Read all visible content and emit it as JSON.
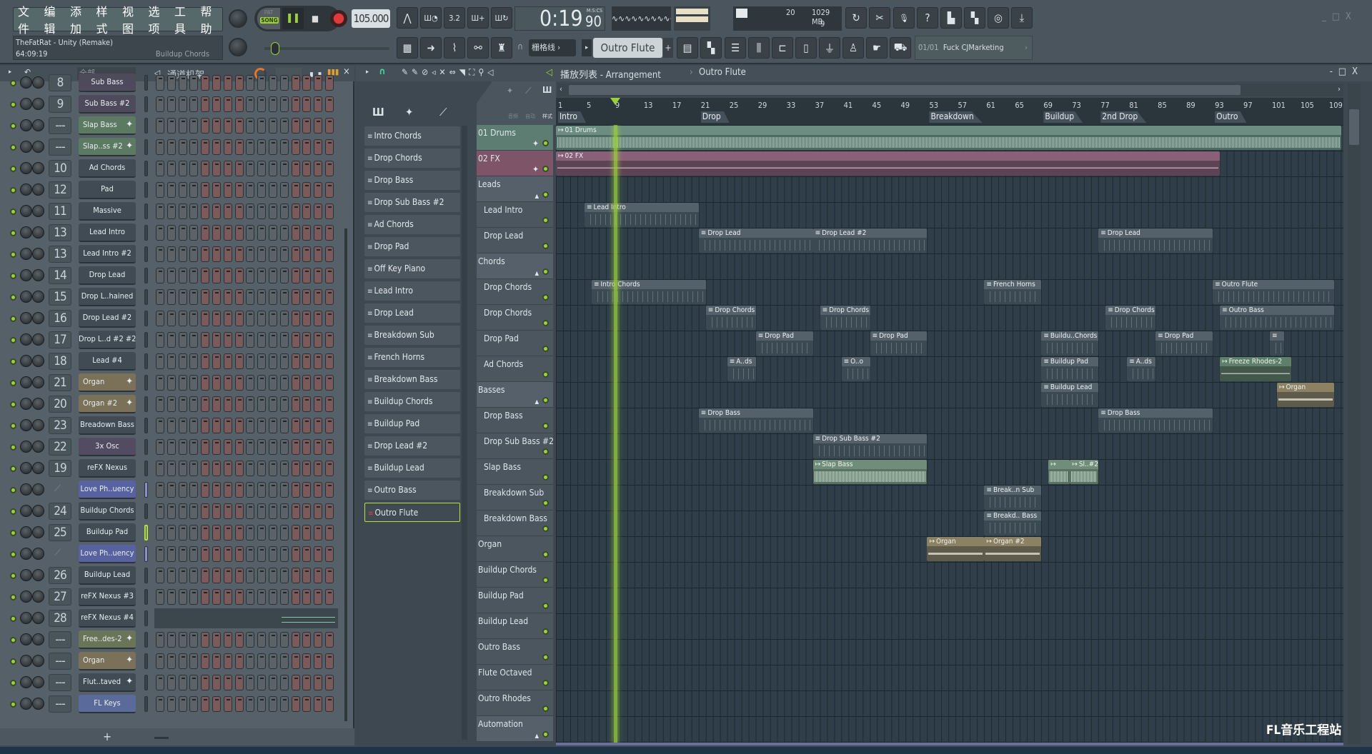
{
  "menu": [
    "文件",
    "编辑",
    "添加",
    "样式",
    "视图",
    "选项",
    "工具",
    "帮助"
  ],
  "transport": {
    "mode_pat": "PAT",
    "mode_song": "SONG",
    "tempo": "105.000",
    "time": "0:19",
    "time_cs": "90",
    "time_format": "M:S:CS"
  },
  "cpu": {
    "polyphony": "20",
    "memory": "1029 MB",
    "voices": "9"
  },
  "song_info": {
    "title": "TheFatRat - Unity (Remake)",
    "time": "64:09:19",
    "hint": "Buildup Chords"
  },
  "snap": "栅格线",
  "current_pattern": "Outro Flute",
  "hint_bar": {
    "index": "01/01",
    "text": "Fuck CJMarketing"
  },
  "toolbar_icons_row1": [
    "tempo-tap-icon",
    "metronome-icon",
    "countdown-icon",
    "step-edit-icon",
    "loop-record-icon"
  ],
  "toolbar_icons_right": [
    "undo-icon",
    "cut-icon",
    "record-audio-icon",
    "help-icon",
    "save-icon",
    "export-icon",
    "chat-icon",
    "download-icon"
  ],
  "toolbar_icons_row2": [
    "piano-roll-icon",
    "arrow-icon",
    "brush-icon",
    "link-icon",
    "stamp-icon"
  ],
  "toolbar_icons_row2b": [
    "playlist-icon",
    "step-seq-icon",
    "channel-rack-icon",
    "mixer-icon",
    "browser-icon",
    "file-icon",
    "plugin-icon",
    "performer-icon",
    "hand-icon",
    "shop-icon"
  ],
  "channel_rack": {
    "filter": "全部",
    "title": "通道机架",
    "add": "+",
    "channels": [
      {
        "num": "8",
        "name": "Sub Bass",
        "color": "#4e4a5c"
      },
      {
        "num": "9",
        "name": "Sub Bass #2",
        "color": "#4e4a5c"
      },
      {
        "num": "---",
        "name": "Slap Bass",
        "color": "#5c7a62",
        "sampler": true
      },
      {
        "num": "---",
        "name": "Slap..ss #2",
        "color": "#5c7a62",
        "sampler": true
      },
      {
        "num": "10",
        "name": "Ad Chords",
        "color": "#414b53"
      },
      {
        "num": "12",
        "name": "Pad",
        "color": "#414b53"
      },
      {
        "num": "11",
        "name": "Massive",
        "color": "#414b53"
      },
      {
        "num": "13",
        "name": "Lead Intro",
        "color": "#414b53"
      },
      {
        "num": "13",
        "name": "Lead Intro #2",
        "color": "#414b53"
      },
      {
        "num": "14",
        "name": "Drop  Lead",
        "color": "#414b53"
      },
      {
        "num": "15",
        "name": "Drop  L..hained",
        "color": "#414b53"
      },
      {
        "num": "16",
        "name": "Drop Lead  #2",
        "color": "#414b53"
      },
      {
        "num": "17",
        "name": "Drop L..d  #2 #2",
        "color": "#414b53"
      },
      {
        "num": "18",
        "name": "Lead #4",
        "color": "#414b53"
      },
      {
        "num": "21",
        "name": "Organ",
        "color": "#7a7158",
        "sampler": true
      },
      {
        "num": "20",
        "name": "Organ  #2",
        "color": "#7a7158",
        "sampler": true
      },
      {
        "num": "23",
        "name": "Breadown Bass",
        "color": "#414b53"
      },
      {
        "num": "22",
        "name": "3x Osc",
        "color": "#524b62"
      },
      {
        "num": "19",
        "name": "reFX Nexus",
        "color": "#414b53"
      },
      {
        "num": "",
        "name": "Love Ph..uency",
        "color": "#5862a0",
        "link": true
      },
      {
        "num": "24",
        "name": "Buildup Chords",
        "color": "#414b53"
      },
      {
        "num": "25",
        "name": "Buildup  Pad",
        "color": "#414b53",
        "selected": true
      },
      {
        "num": "",
        "name": "Love Ph..uency",
        "color": "#5862a0",
        "link": true
      },
      {
        "num": "26",
        "name": "Buildup  Lead",
        "color": "#414b53"
      },
      {
        "num": "27",
        "name": "reFX Nexus #3",
        "color": "#414b53"
      },
      {
        "num": "28",
        "name": "reFX Nexus #4",
        "color": "#414b53",
        "pianoroll": true
      },
      {
        "num": "---",
        "name": "Free..des-2",
        "color": "#6a7458",
        "sampler": true
      },
      {
        "num": "---",
        "name": "Organ",
        "color": "#7a7158",
        "sampler": true
      },
      {
        "num": "---",
        "name": "Flut..taved",
        "color": "#414b53",
        "sampler": true
      },
      {
        "num": "---",
        "name": "FL Keys",
        "color": "#5a6a9a"
      }
    ],
    "steps_per_pattern": 16
  },
  "playlist": {
    "title": "播放列表 - Arrangement",
    "pattern": "Outro Flute",
    "filter_labels": [
      "音频",
      "自动",
      "样式"
    ],
    "picker": [
      "Intro Chords",
      "Drop  Chords",
      "Drop Bass",
      "Drop Sub Bass #2",
      "Ad Chords",
      "Drop  Pad",
      "Off Key Piano",
      "Lead Intro",
      "Drop Lead",
      "Breakdown Sub",
      "French Horns",
      "Breakdown  Bass",
      "Buildup  Chords",
      "Buildup Pad",
      "Drop  Lead #2",
      "Buildup  Lead",
      "Outro Bass",
      "Outro  Flute"
    ],
    "picker_selected": 17,
    "ruler": [
      "1",
      "5",
      "9",
      "13",
      "17",
      "21",
      "25",
      "29",
      "33",
      "37",
      "41",
      "45",
      "49",
      "53",
      "57",
      "61",
      "65",
      "69",
      "73",
      "77",
      "81",
      "85",
      "89",
      "93",
      "97",
      "101",
      "105",
      "109"
    ],
    "markers": [
      {
        "label": "Intro",
        "bar": 1
      },
      {
        "label": "Drop",
        "bar": 21
      },
      {
        "label": "Breakdown",
        "bar": 53
      },
      {
        "label": "Buildup",
        "bar": 69
      },
      {
        "label": "2nd Drop",
        "bar": 77
      },
      {
        "label": "Outro",
        "bar": 93
      }
    ],
    "playhead_bar": 9.3,
    "tracks": [
      {
        "name": "01 Drums",
        "type": "drums"
      },
      {
        "name": "02 FX",
        "type": "fx"
      },
      {
        "name": "Leads",
        "type": "group"
      },
      {
        "name": "Lead Intro",
        "type": "child"
      },
      {
        "name": "Drop Lead",
        "type": "child"
      },
      {
        "name": "Chords",
        "type": "group"
      },
      {
        "name": "Drop  Chords",
        "type": "child"
      },
      {
        "name": "Drop  Chords",
        "type": "child"
      },
      {
        "name": "Drop  Pad",
        "type": "child"
      },
      {
        "name": "Ad Chords",
        "type": "child"
      },
      {
        "name": "Basses",
        "type": "group"
      },
      {
        "name": "Drop Bass",
        "type": "child"
      },
      {
        "name": "Drop Sub Bass #2",
        "type": "child"
      },
      {
        "name": "Slap  Bass",
        "type": "child"
      },
      {
        "name": "Breakdown Sub",
        "type": "child"
      },
      {
        "name": "Breakdown Bass",
        "type": "child"
      },
      {
        "name": "Organ",
        "type": "plain"
      },
      {
        "name": "Buildup Chords",
        "type": "plain"
      },
      {
        "name": "Buildup Pad",
        "type": "plain"
      },
      {
        "name": "Buildup Lead",
        "type": "plain"
      },
      {
        "name": "Outro Bass",
        "type": "plain"
      },
      {
        "name": "Flute Octaved",
        "type": "plain"
      },
      {
        "name": "Outro  Rhodes",
        "type": "plain"
      },
      {
        "name": "Automation",
        "type": "group"
      }
    ],
    "clips": [
      {
        "track": 0,
        "start": 1,
        "end": 111,
        "label": "01 Drums",
        "kind": "drums"
      },
      {
        "track": 1,
        "start": 1,
        "end": 94,
        "label": "02 FX",
        "kind": "fx"
      },
      {
        "track": 3,
        "start": 5,
        "end": 21,
        "label": "Lead Intro",
        "kind": "pattern"
      },
      {
        "track": 4,
        "start": 21,
        "end": 37,
        "label": "Drop Lead",
        "kind": "pattern"
      },
      {
        "track": 4,
        "start": 37,
        "end": 53,
        "label": "Drop  Lead #2",
        "kind": "pattern"
      },
      {
        "track": 4,
        "start": 77,
        "end": 93,
        "label": "Drop Lead",
        "kind": "pattern"
      },
      {
        "track": 6,
        "start": 6,
        "end": 22,
        "label": "Intro Chords",
        "kind": "pattern"
      },
      {
        "track": 6,
        "start": 61,
        "end": 69,
        "label": "French Horns",
        "kind": "pattern"
      },
      {
        "track": 6,
        "start": 93,
        "end": 110,
        "label": "Outro  Flute",
        "kind": "pattern"
      },
      {
        "track": 7,
        "start": 22,
        "end": 29,
        "label": "Drop  Chords",
        "kind": "pattern"
      },
      {
        "track": 7,
        "start": 38,
        "end": 45,
        "label": "Drop  Chords",
        "kind": "pattern"
      },
      {
        "track": 7,
        "start": 78,
        "end": 85,
        "label": "Drop  Chords",
        "kind": "pattern"
      },
      {
        "track": 7,
        "start": 94,
        "end": 110,
        "label": "Outro Bass",
        "kind": "pattern"
      },
      {
        "track": 8,
        "start": 29,
        "end": 37,
        "label": "Drop  Pad",
        "kind": "pattern"
      },
      {
        "track": 8,
        "start": 45,
        "end": 53,
        "label": "Drop  Pad",
        "kind": "pattern"
      },
      {
        "track": 8,
        "start": 69,
        "end": 77,
        "label": "Buildu..Chords",
        "kind": "pattern"
      },
      {
        "track": 8,
        "start": 85,
        "end": 93,
        "label": "Drop  Pad",
        "kind": "pattern"
      },
      {
        "track": 8,
        "start": 101,
        "end": 103,
        "label": "",
        "kind": "pattern"
      },
      {
        "track": 9,
        "start": 25,
        "end": 29,
        "label": "A..ds",
        "kind": "pattern"
      },
      {
        "track": 9,
        "start": 41,
        "end": 45,
        "label": "O..o",
        "kind": "pattern"
      },
      {
        "track": 9,
        "start": 69,
        "end": 77,
        "label": "Buildup  Pad",
        "kind": "pattern"
      },
      {
        "track": 9,
        "start": 81,
        "end": 85,
        "label": "A..ds",
        "kind": "pattern"
      },
      {
        "track": 9,
        "start": 94,
        "end": 104,
        "label": "Freeze Rhodes-2",
        "kind": "freeze"
      },
      {
        "track": 10,
        "start": 69,
        "end": 77,
        "label": "Buildup Lead",
        "kind": "pattern"
      },
      {
        "track": 10,
        "start": 102,
        "end": 110,
        "label": "Organ",
        "kind": "organ"
      },
      {
        "track": 11,
        "start": 21,
        "end": 37,
        "label": "Drop Bass",
        "kind": "pattern"
      },
      {
        "track": 11,
        "start": 77,
        "end": 93,
        "label": "Drop Bass",
        "kind": "pattern"
      },
      {
        "track": 12,
        "start": 37,
        "end": 53,
        "label": "Drop Sub Bass #2",
        "kind": "pattern"
      },
      {
        "track": 13,
        "start": 37,
        "end": 53,
        "label": "Slap Bass",
        "kind": "audio"
      },
      {
        "track": 13,
        "start": 70,
        "end": 73,
        "label": "",
        "kind": "audio"
      },
      {
        "track": 13,
        "start": 73,
        "end": 77,
        "label": "Sl..#2",
        "kind": "audio"
      },
      {
        "track": 14,
        "start": 61,
        "end": 69,
        "label": "Break..n Sub",
        "kind": "pattern"
      },
      {
        "track": 15,
        "start": 61,
        "end": 69,
        "label": "Breakd.. Bass",
        "kind": "pattern"
      },
      {
        "track": 16,
        "start": 53,
        "end": 61,
        "label": "Organ",
        "kind": "organ"
      },
      {
        "track": 16,
        "start": 61,
        "end": 69,
        "label": "Organ  #2",
        "kind": "organ"
      }
    ]
  },
  "colors": {
    "accent": "#9bd23c",
    "drums": "#5d7d72",
    "fx": "#7d5468",
    "pattern": "#55616a",
    "organ": "#7f7459",
    "audio": "#5f7a66"
  },
  "watermark": "FL音乐工程站"
}
